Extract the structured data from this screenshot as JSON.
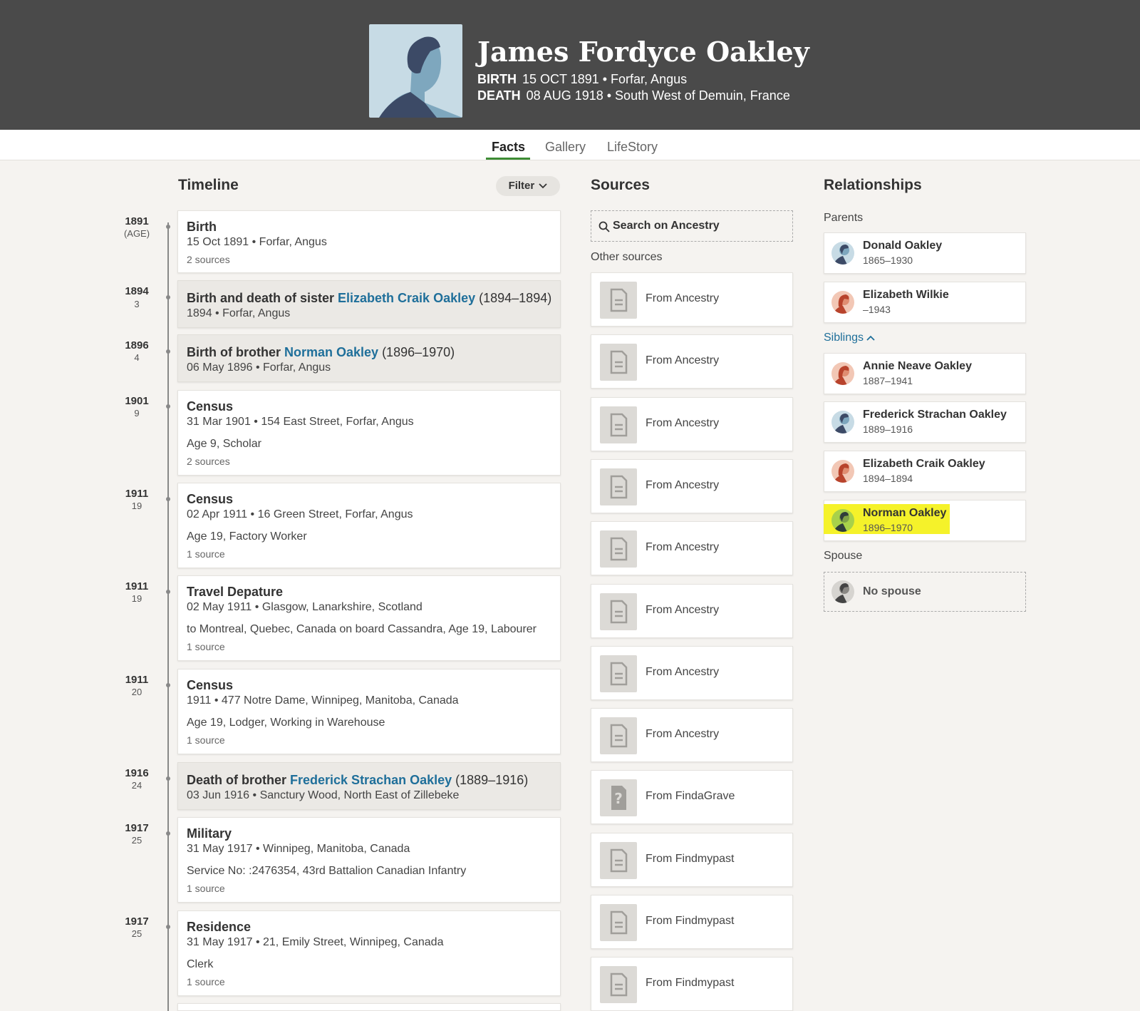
{
  "person": {
    "name": "James Fordyce Oakley",
    "birth_label": "BIRTH",
    "birth_value": "15 OCT 1891 • Forfar, Angus",
    "death_label": "DEATH",
    "death_value": "08 AUG 1918 • South West of Demuin, France"
  },
  "tabs": [
    "Facts",
    "Gallery",
    "LifeStory"
  ],
  "timeline": {
    "title": "Timeline",
    "filter_label": "Filter",
    "events": [
      {
        "year": "1891",
        "age": "(AGE)",
        "title": "Birth",
        "sub": "15 Oct 1891 • Forfar, Angus",
        "sources": "2 sources"
      },
      {
        "year": "1894",
        "age": "3",
        "title_pre": "Birth and death of sister ",
        "title_link": "Elizabeth Craik Oakley",
        "title_post": " (1894–1894)",
        "sub": "1894 • Forfar, Angus"
      },
      {
        "year": "1896",
        "age": "4",
        "title_pre": "Birth of brother ",
        "title_link": "Norman Oakley",
        "title_post": " (1896–1970)",
        "sub": "06 May 1896 • Forfar, Angus"
      },
      {
        "year": "1901",
        "age": "9",
        "title": "Census",
        "sub": "31 Mar 1901 • 154 East Street, Forfar, Angus",
        "desc": "Age 9, Scholar",
        "sources": "2 sources"
      },
      {
        "year": "1911",
        "age": "19",
        "title": "Census",
        "sub": "02 Apr 1911 • 16 Green Street, Forfar, Angus",
        "desc": "Age 19, Factory Worker",
        "sources": "1 source"
      },
      {
        "year": "1911",
        "age": "19",
        "title": "Travel Depature",
        "sub": "02 May 1911 • Glasgow, Lanarkshire, Scotland",
        "desc": "to Montreal, Quebec, Canada on board Cassandra, Age 19, Labourer",
        "sources": "1 source"
      },
      {
        "year": "1911",
        "age": "20",
        "title": "Census",
        "sub": "1911 • 477 Notre Dame, Winnipeg, Manitoba, Canada",
        "desc": "Age 19, Lodger, Working in Warehouse",
        "sources": "1 source"
      },
      {
        "year": "1916",
        "age": "24",
        "title_pre": "Death of brother ",
        "title_link": "Frederick Strachan Oakley",
        "title_post": " (1889–1916)",
        "sub": "03 Jun 1916 • Sanctury Wood, North East of Zillebeke"
      },
      {
        "year": "1917",
        "age": "25",
        "title": "Military",
        "sub": "31 May 1917 • Winnipeg, Manitoba, Canada",
        "desc": "Service No: :2476354, 43rd Battalion Canadian Infantry",
        "sources": "1 source"
      },
      {
        "year": "1917",
        "age": "25",
        "title": "Residence",
        "sub": "31 May 1917 • 21, Emily Street, Winnipeg, Canada",
        "desc": "Clerk",
        "sources": "1 source"
      }
    ]
  },
  "sources": {
    "title": "Sources",
    "search_label": "Search on Ancestry",
    "other_label": "Other sources",
    "items": [
      {
        "label": "From Ancestry",
        "icon": "document-icon"
      },
      {
        "label": "From Ancestry",
        "icon": "document-icon"
      },
      {
        "label": "From Ancestry",
        "icon": "document-icon"
      },
      {
        "label": "From Ancestry",
        "icon": "document-icon"
      },
      {
        "label": "From Ancestry",
        "icon": "document-icon"
      },
      {
        "label": "From Ancestry",
        "icon": "document-icon"
      },
      {
        "label": "From Ancestry",
        "icon": "document-icon"
      },
      {
        "label": "From Ancestry",
        "icon": "document-icon"
      },
      {
        "label": "From FindaGrave",
        "icon": "question-icon"
      },
      {
        "label": "From Findmypast",
        "icon": "document-icon"
      },
      {
        "label": "From Findmypast",
        "icon": "document-icon"
      },
      {
        "label": "From Findmypast",
        "icon": "document-icon"
      }
    ]
  },
  "relationships": {
    "title": "Relationships",
    "parents_label": "Parents",
    "parents": [
      {
        "name": "Donald Oakley",
        "years": "1865–1930",
        "gender": "male"
      },
      {
        "name": "Elizabeth Wilkie",
        "years": "–1943",
        "gender": "female"
      }
    ],
    "siblings_label": "Siblings",
    "siblings": [
      {
        "name": "Annie Neave Oakley",
        "years": "1887–1941",
        "gender": "female"
      },
      {
        "name": "Frederick Strachan Oakley",
        "years": "1889–1916",
        "gender": "male"
      },
      {
        "name": "Elizabeth Craik Oakley",
        "years": "1894–1894",
        "gender": "female"
      },
      {
        "name": "Norman Oakley",
        "years": "1896–1970",
        "gender": "male",
        "highlighted": true
      }
    ],
    "spouse_label": "Spouse",
    "spouse_text": "No spouse"
  },
  "colors": {
    "header_bg": "#4a4a4a",
    "accent_green": "#3d8c34",
    "link_blue": "#1f6f9a",
    "highlight": "#f5f22a"
  }
}
